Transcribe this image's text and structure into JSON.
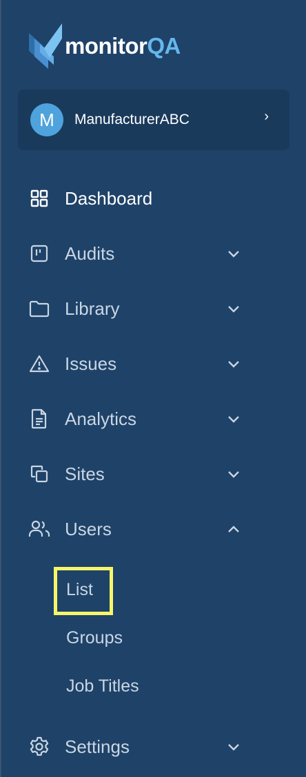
{
  "brand": {
    "name_part1": "monitor",
    "name_part2": "QA"
  },
  "org": {
    "initial": "M",
    "name": "ManufacturerABC",
    "chevron": "›"
  },
  "nav": {
    "dashboard": {
      "label": "Dashboard",
      "icon": "grid-icon"
    },
    "audits": {
      "label": "Audits",
      "icon": "kanban-icon"
    },
    "library": {
      "label": "Library",
      "icon": "folder-icon"
    },
    "issues": {
      "label": "Issues",
      "icon": "warning-icon"
    },
    "analytics": {
      "label": "Analytics",
      "icon": "document-icon"
    },
    "sites": {
      "label": "Sites",
      "icon": "copy-icon"
    },
    "users": {
      "label": "Users",
      "icon": "users-icon",
      "expanded": true,
      "sub_items": [
        "List",
        "Groups",
        "Job Titles"
      ]
    },
    "settings": {
      "label": "Settings",
      "icon": "gear-icon"
    }
  },
  "colors": {
    "sidebar_bg": "#1f4268",
    "org_bg": "#1a3a5c",
    "avatar": "#4fa3dd",
    "brand_accent": "#64b8ec",
    "highlight": "#f7f56a"
  }
}
